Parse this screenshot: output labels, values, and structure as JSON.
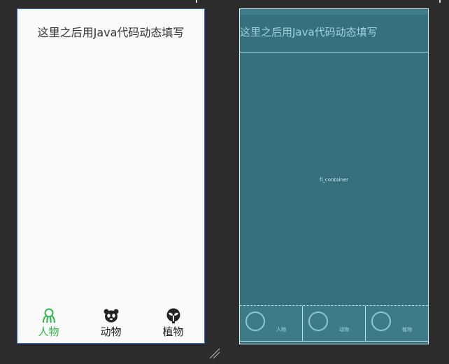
{
  "design_preview": {
    "title": "这里之后用Java代码动态填写",
    "tabs": [
      {
        "label": "人物",
        "icon": "person-icon",
        "active": true
      },
      {
        "label": "动物",
        "icon": "panda-icon",
        "active": false
      },
      {
        "label": "植物",
        "icon": "plant-icon",
        "active": false
      }
    ]
  },
  "blueprint_preview": {
    "title": "这里之后用Java代码动态填写",
    "container_label": "fl_container",
    "slots": [
      {
        "label": "人物"
      },
      {
        "label": "动物"
      },
      {
        "label": "植物"
      }
    ]
  },
  "colors": {
    "active_tab": "#2fb84a",
    "design_border": "#2f6fd1",
    "blueprint_bg": "#36707f"
  }
}
